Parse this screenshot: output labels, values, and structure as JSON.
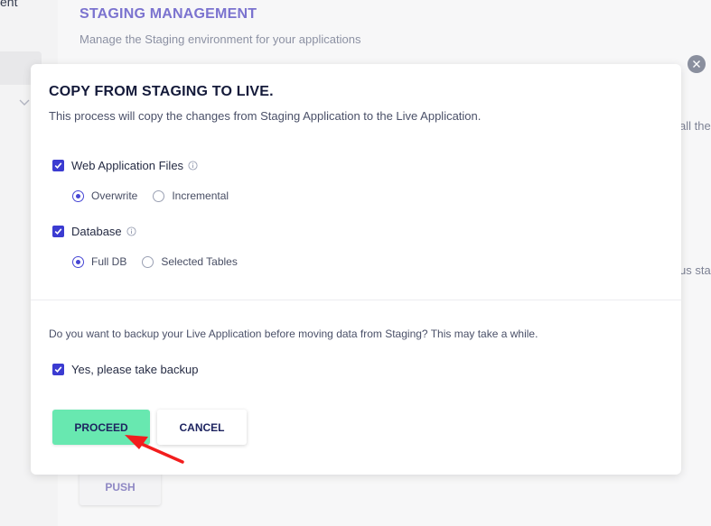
{
  "sidebar": {
    "fragment_text": "ent"
  },
  "main": {
    "title": "STAGING MANAGEMENT",
    "subtitle": "Manage the Staging environment for your applications",
    "fragment_right_1": "all the",
    "fragment_right_2": "us sta",
    "push_label": "PUSH"
  },
  "modal": {
    "title": "COPY FROM STAGING TO LIVE.",
    "description": "This process will copy the changes from Staging Application to the Live Application.",
    "web_files": {
      "label": "Web Application Files",
      "checked": true,
      "options": [
        {
          "label": "Overwrite",
          "selected": true
        },
        {
          "label": "Incremental",
          "selected": false
        }
      ]
    },
    "database": {
      "label": "Database",
      "checked": true,
      "options": [
        {
          "label": "Full DB",
          "selected": true
        },
        {
          "label": "Selected Tables",
          "selected": false
        }
      ]
    },
    "backup_question": "Do you want to backup your Live Application before moving data from Staging? This may take a while.",
    "backup": {
      "label": "Yes, please take backup",
      "checked": true
    },
    "proceed_label": "PROCEED",
    "cancel_label": "CANCEL"
  },
  "colors": {
    "accent": "#7b73cf",
    "checkbox": "#3b3bd1",
    "proceed": "#68e8b0",
    "arrow": "#f21d1d"
  }
}
